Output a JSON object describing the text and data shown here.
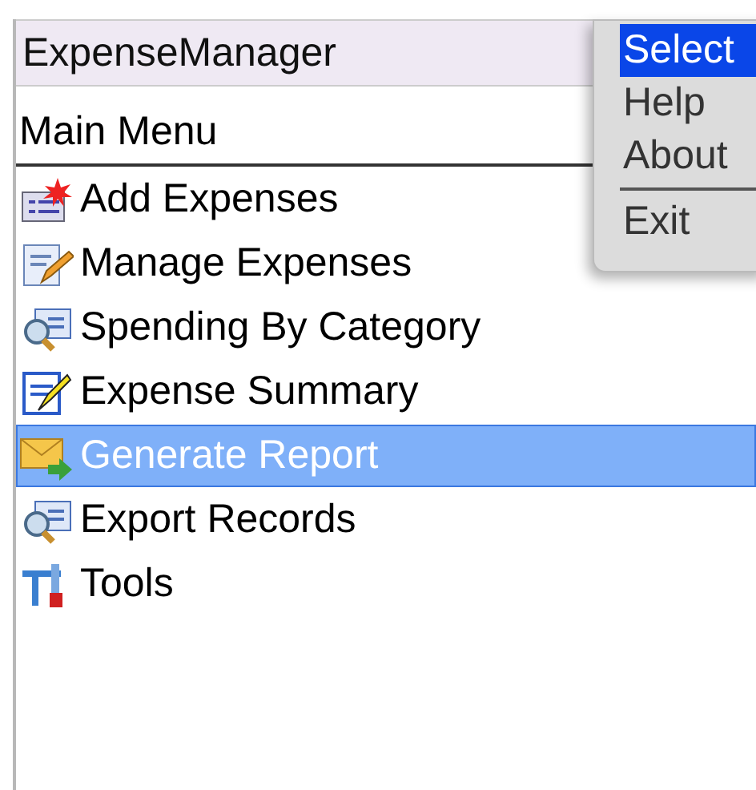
{
  "window": {
    "title": "ExpenseManager"
  },
  "header": "Main Menu",
  "items": [
    {
      "label": "Add Expenses",
      "kind": "add",
      "selected": false
    },
    {
      "label": "Manage Expenses",
      "kind": "edit",
      "selected": false
    },
    {
      "label": "Spending By Category",
      "kind": "search",
      "selected": false
    },
    {
      "label": "Expense Summary",
      "kind": "notepad",
      "selected": false
    },
    {
      "label": "Generate Report",
      "kind": "mail",
      "selected": true
    },
    {
      "label": "Export Records",
      "kind": "search",
      "selected": false
    },
    {
      "label": "Tools",
      "kind": "tools",
      "selected": false
    }
  ],
  "popup_menu": [
    {
      "label": "Select",
      "selected": true,
      "divider_before": false
    },
    {
      "label": "Help",
      "selected": false,
      "divider_before": false
    },
    {
      "label": "About",
      "selected": false,
      "divider_before": false
    },
    {
      "label": "Exit",
      "selected": false,
      "divider_before": true
    }
  ]
}
